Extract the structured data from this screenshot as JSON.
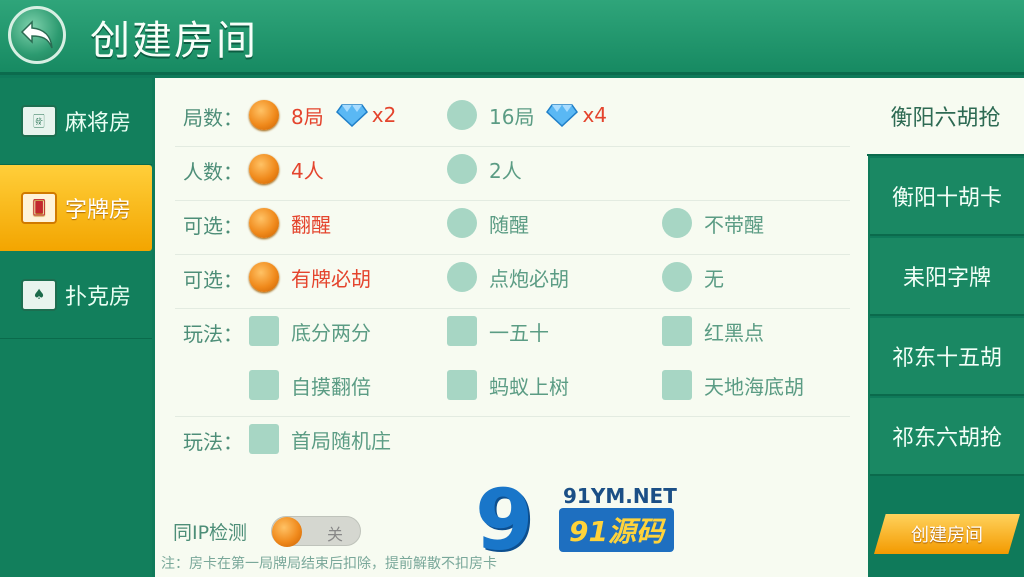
{
  "header": {
    "title": "创建房间"
  },
  "left_nav": [
    {
      "label": "麻将房",
      "icon": "mahjong-tile-icon",
      "active": false
    },
    {
      "label": "字牌房",
      "icon": "word-cards-icon",
      "active": true
    },
    {
      "label": "扑克房",
      "icon": "poker-cards-icon",
      "active": false
    }
  ],
  "settings": {
    "rounds": {
      "label": "局数：",
      "opt1": "8局",
      "opt1_cost": "x2",
      "opt2": "16局",
      "opt2_cost": "x4"
    },
    "players": {
      "label": "人数：",
      "opt1": "4人",
      "opt2": "2人"
    },
    "optional1": {
      "label": "可选：",
      "opt1": "翻醒",
      "opt2": "随醒",
      "opt3": "不带醒"
    },
    "optional2": {
      "label": "可选：",
      "opt1": "有牌必胡",
      "opt2": "点炮必胡",
      "opt3": "无"
    },
    "gameplay1": {
      "label": "玩法：",
      "opt1": "底分两分",
      "opt2": "一五十",
      "opt3": "红黑点",
      "opt4": "自摸翻倍",
      "opt5": "蚂蚁上树",
      "opt6": "天地海底胡"
    },
    "gameplay2": {
      "label": "玩法：",
      "opt1": "首局随机庄"
    }
  },
  "ip_check": {
    "label": "同IP检测",
    "state": "关"
  },
  "note": "注：房卡在第一局牌局结束后扣除，提前解散不扣房卡",
  "watermark": {
    "digit": "9",
    "domain": "91YM.NET",
    "brand": "91源码"
  },
  "modes": [
    "衡阳六胡抢",
    "衡阳十胡卡",
    "耒阳字牌",
    "祁东十五胡",
    "祁东六胡抢"
  ],
  "create_button": "创建房间",
  "colors": {
    "primary_green": "#178a62",
    "accent_orange": "#f08a1c",
    "selected_text": "#e4442d",
    "option_text": "#5b9c84"
  }
}
